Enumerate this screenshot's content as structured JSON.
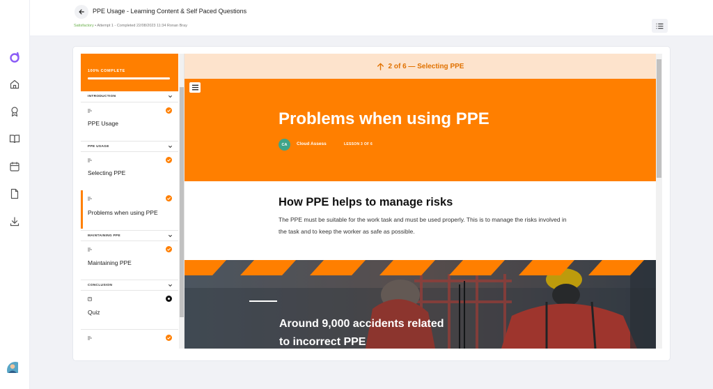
{
  "header": {
    "title": "PPE Usage - Learning Content & Self Paced Questions",
    "status": "Satisfactory",
    "meta": " • Attempt 1 - Completed 22/08/2023 11:34 Ronan Bray"
  },
  "rail": {
    "icons": [
      "logo-icon",
      "home-icon",
      "award-icon",
      "book-icon",
      "calendar-icon",
      "file-icon",
      "download-icon"
    ]
  },
  "sidebar": {
    "progress_label": "100% COMPLETE",
    "progress_fraction": 1.0,
    "sections": [
      {
        "title": "INTRODUCTION",
        "lessons": [
          {
            "name": "PPE Usage",
            "status": "complete"
          }
        ]
      },
      {
        "title": "PPE USAGE",
        "lessons": [
          {
            "name": "Selecting PPE",
            "status": "complete"
          },
          {
            "name": "Problems when using PPE",
            "status": "complete",
            "active": true
          }
        ]
      },
      {
        "title": "MAINTAINING PPE",
        "lessons": [
          {
            "name": "Maintaining PPE",
            "status": "complete"
          }
        ]
      },
      {
        "title": "CONCLUSION",
        "lessons": [
          {
            "name": "Quiz",
            "status": "current"
          }
        ]
      }
    ]
  },
  "viewer": {
    "nav_text": "2 of 6 — Selecting PPE",
    "hero_title": "Problems when using PPE",
    "author_initials": "CA",
    "author": "Cloud Assess",
    "lesson_count": "LESSON 3 OF 6",
    "section_title": "How PPE helps to manage risks",
    "section_body": "The PPE must be suitable for the work task and must be used properly. This is to manage the risks involved in the task and to keep the worker as safe as possible.",
    "photo_text": "Around 9,000 accidents related to incorrect PPE"
  },
  "colors": {
    "accent": "#ff7f00",
    "banner_bg": "#fde3cc",
    "banner_text": "#e07100",
    "status_ok": "#6ab04c",
    "brand": "#7c5cff"
  }
}
